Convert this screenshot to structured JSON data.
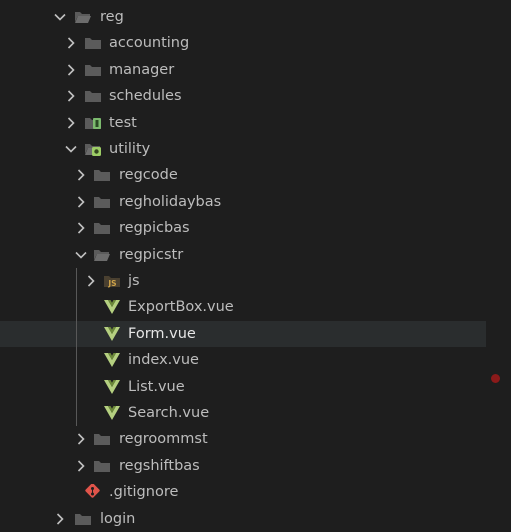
{
  "explorer": {
    "items": [
      {
        "label": "reg",
        "kind": "folder-open",
        "depth": 0
      },
      {
        "label": "accounting",
        "kind": "folder",
        "depth": 1
      },
      {
        "label": "manager",
        "kind": "folder",
        "depth": 1
      },
      {
        "label": "schedules",
        "kind": "folder",
        "depth": 1
      },
      {
        "label": "test",
        "kind": "test-folder",
        "depth": 1
      },
      {
        "label": "utility",
        "kind": "utility-folder-open",
        "depth": 1
      },
      {
        "label": "regcode",
        "kind": "folder",
        "depth": 2
      },
      {
        "label": "regholidaybas",
        "kind": "folder",
        "depth": 2
      },
      {
        "label": "regpicbas",
        "kind": "folder",
        "depth": 2
      },
      {
        "label": "regpicstr",
        "kind": "folder-open",
        "depth": 2
      },
      {
        "label": "js",
        "kind": "js-folder",
        "depth": 3
      },
      {
        "label": "ExportBox.vue",
        "kind": "vue-file",
        "depth": 3
      },
      {
        "label": "Form.vue",
        "kind": "vue-file",
        "depth": 3,
        "selected": true
      },
      {
        "label": "index.vue",
        "kind": "vue-file",
        "depth": 3
      },
      {
        "label": "List.vue",
        "kind": "vue-file",
        "depth": 3
      },
      {
        "label": "Search.vue",
        "kind": "vue-file",
        "depth": 3
      },
      {
        "label": "regroommst",
        "kind": "folder",
        "depth": 2
      },
      {
        "label": "regshiftbas",
        "kind": "folder",
        "depth": 2
      },
      {
        "label": ".gitignore",
        "kind": "git-file",
        "depth": 1
      },
      {
        "label": "login",
        "kind": "folder",
        "depth": 0
      }
    ]
  },
  "colors": {
    "folder": "#5b5b5b",
    "vue": "#b5d080",
    "git": "#e0544a",
    "js": "#cfa44a",
    "test": "#7cba6e",
    "breakpoint": "#8b1a1a"
  }
}
